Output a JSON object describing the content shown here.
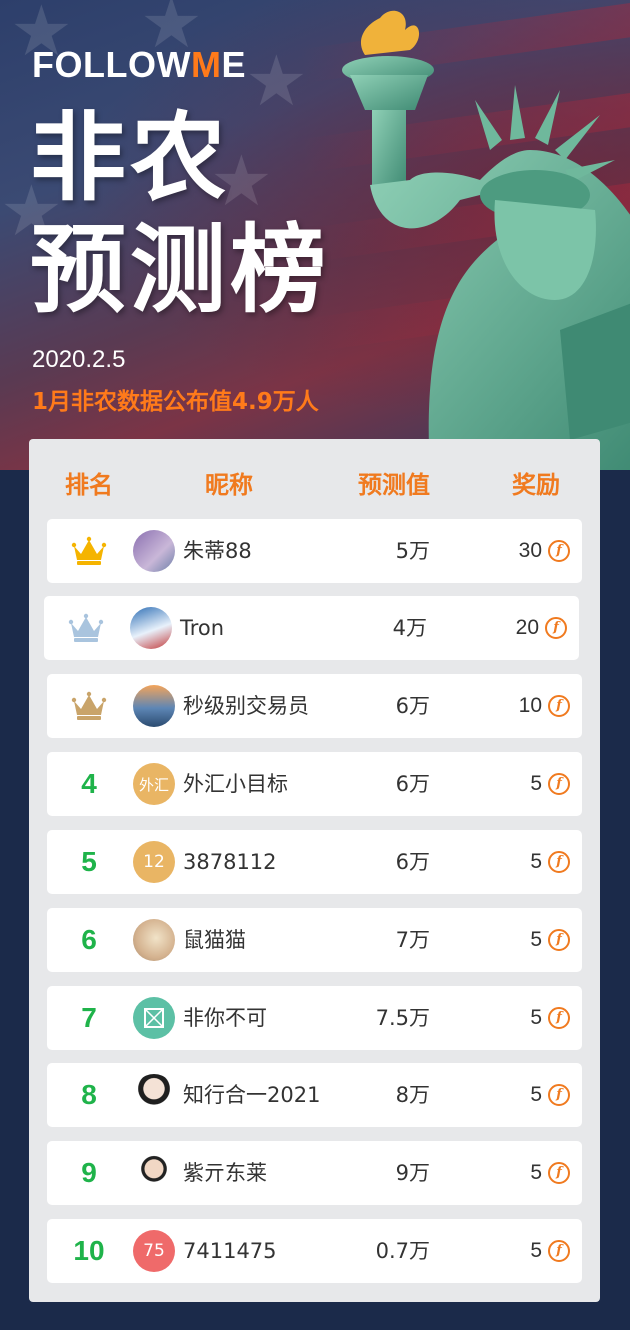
{
  "brand": {
    "logo_left": "FOLLOW",
    "logo_v": "M",
    "logo_right": "E"
  },
  "title": {
    "line1": "非农",
    "line2": "预测榜"
  },
  "date": "2020.2.5",
  "subtitle": "1月非农数据公布值4.9万人",
  "colors": {
    "accent": "#f07a1f",
    "rank_green": "#1fb34a",
    "gold": "#f5b400",
    "silver": "#a9c4de",
    "bronze": "#c9a46a"
  },
  "table": {
    "headers": {
      "rank": "排名",
      "nickname": "昵称",
      "prediction": "预测值",
      "reward": "奖励"
    },
    "rows": [
      {
        "rank": "",
        "rank_icon": "crown-gold-icon",
        "avatar_text": "",
        "avatar_icon": "bunny-avatar-icon",
        "nickname": "朱蒂88",
        "prediction": "5万",
        "reward": "30"
      },
      {
        "rank": "",
        "rank_icon": "crown-silver-icon",
        "avatar_text": "",
        "avatar_icon": "ski-avatar-icon",
        "nickname": "Tron",
        "prediction": "4万",
        "reward": "20"
      },
      {
        "rank": "",
        "rank_icon": "crown-bronze-icon",
        "avatar_text": "",
        "avatar_icon": "lake-avatar-icon",
        "nickname": "秒级别交易员",
        "prediction": "6万",
        "reward": "10"
      },
      {
        "rank": "4",
        "avatar_text": "外汇",
        "nickname": "外汇小目标",
        "prediction": "6万",
        "reward": "5"
      },
      {
        "rank": "5",
        "avatar_text": "12",
        "nickname": "3878112",
        "prediction": "6万",
        "reward": "5"
      },
      {
        "rank": "6",
        "avatar_text": "",
        "avatar_icon": "mouse-avatar-icon",
        "nickname": "鼠猫猫",
        "prediction": "7万",
        "reward": "5"
      },
      {
        "rank": "7",
        "avatar_text": "",
        "avatar_icon": "image-placeholder-icon",
        "nickname": "非你不可",
        "prediction": "7.5万",
        "reward": "5"
      },
      {
        "rank": "8",
        "avatar_text": "",
        "avatar_icon": "woman-avatar-icon",
        "nickname": "知行合一2021",
        "prediction": "8万",
        "reward": "5"
      },
      {
        "rank": "9",
        "avatar_text": "",
        "avatar_icon": "man-avatar-icon",
        "nickname": "紫亓东莱",
        "prediction": "9万",
        "reward": "5"
      },
      {
        "rank": "10",
        "avatar_text": "75",
        "nickname": "7411475",
        "prediction": "0.7万",
        "reward": "5"
      }
    ],
    "coin_glyph": "f"
  }
}
